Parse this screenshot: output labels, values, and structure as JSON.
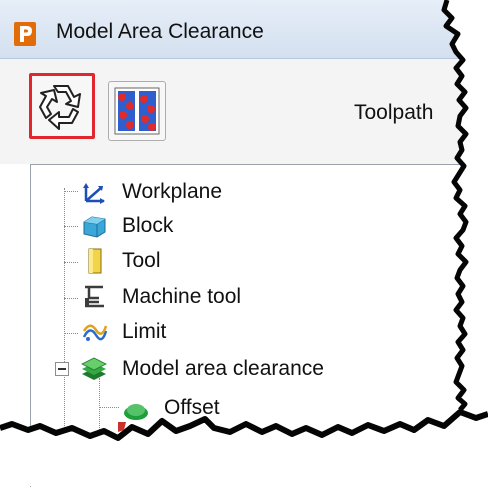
{
  "window": {
    "title": "Model Area Clearance",
    "app_icon": "powermill-p-icon",
    "accent_color": "#e36c0a"
  },
  "toolbar": {
    "buttons": [
      {
        "name": "recycle-button",
        "icon": "recycle-arrows-icon",
        "selected": true
      },
      {
        "name": "pattern-button",
        "icon": "pattern-icon",
        "selected": false
      }
    ],
    "toolpath_label": "Toolpath",
    "selection_color": "#e2262d"
  },
  "tree": {
    "items": [
      {
        "label": "Workplane",
        "icon": "workplane-axes-icon"
      },
      {
        "label": "Block",
        "icon": "block-cube-icon"
      },
      {
        "label": "Tool",
        "icon": "tool-icon"
      },
      {
        "label": "Machine tool",
        "icon": "machine-tool-icon"
      },
      {
        "label": "Limit",
        "icon": "limit-icon"
      },
      {
        "label": "Model area clearance",
        "icon": "layers-icon",
        "expanded": true
      },
      {
        "label": "Offset",
        "icon": "offset-icon",
        "child": true
      }
    ]
  }
}
